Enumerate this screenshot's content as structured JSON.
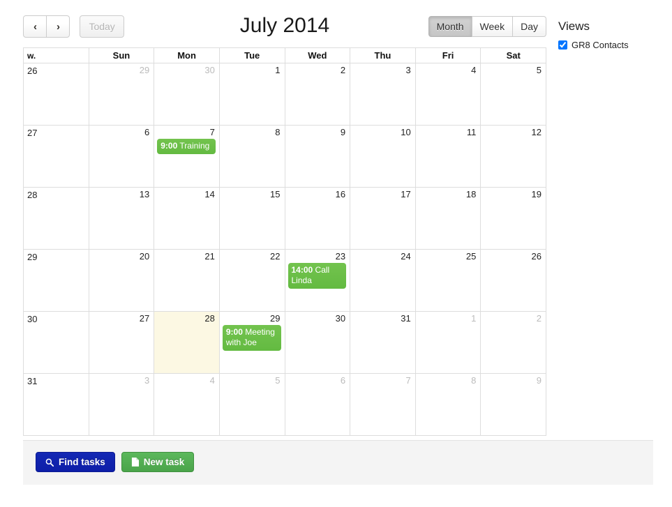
{
  "toolbar": {
    "prev_label": "‹",
    "next_label": "›",
    "prev_icon": "chevron-left-icon",
    "next_icon": "chevron-right-icon",
    "today_label": "Today",
    "title": "July 2014",
    "views": [
      {
        "label": "Month",
        "active": true
      },
      {
        "label": "Week",
        "active": false
      },
      {
        "label": "Day",
        "active": false
      }
    ]
  },
  "views_panel": {
    "title": "Views",
    "items": [
      {
        "label": "GR8 Contacts",
        "checked": true
      }
    ]
  },
  "calendar": {
    "week_header": "w.",
    "day_headers": [
      "Sun",
      "Mon",
      "Tue",
      "Wed",
      "Thu",
      "Fri",
      "Sat"
    ],
    "weeks": [
      {
        "week": "26",
        "days": [
          {
            "num": "29",
            "other": true,
            "today": false,
            "events": []
          },
          {
            "num": "30",
            "other": true,
            "today": false,
            "events": []
          },
          {
            "num": "1",
            "other": false,
            "today": false,
            "events": []
          },
          {
            "num": "2",
            "other": false,
            "today": false,
            "events": []
          },
          {
            "num": "3",
            "other": false,
            "today": false,
            "events": []
          },
          {
            "num": "4",
            "other": false,
            "today": false,
            "events": []
          },
          {
            "num": "5",
            "other": false,
            "today": false,
            "events": []
          }
        ]
      },
      {
        "week": "27",
        "days": [
          {
            "num": "6",
            "other": false,
            "today": false,
            "events": []
          },
          {
            "num": "7",
            "other": false,
            "today": false,
            "events": [
              {
                "time": "9:00",
                "title": "Training",
                "color": "#66bb44"
              }
            ]
          },
          {
            "num": "8",
            "other": false,
            "today": false,
            "events": []
          },
          {
            "num": "9",
            "other": false,
            "today": false,
            "events": []
          },
          {
            "num": "10",
            "other": false,
            "today": false,
            "events": []
          },
          {
            "num": "11",
            "other": false,
            "today": false,
            "events": []
          },
          {
            "num": "12",
            "other": false,
            "today": false,
            "events": []
          }
        ]
      },
      {
        "week": "28",
        "days": [
          {
            "num": "13",
            "other": false,
            "today": false,
            "events": []
          },
          {
            "num": "14",
            "other": false,
            "today": false,
            "events": []
          },
          {
            "num": "15",
            "other": false,
            "today": false,
            "events": []
          },
          {
            "num": "16",
            "other": false,
            "today": false,
            "events": []
          },
          {
            "num": "17",
            "other": false,
            "today": false,
            "events": []
          },
          {
            "num": "18",
            "other": false,
            "today": false,
            "events": []
          },
          {
            "num": "19",
            "other": false,
            "today": false,
            "events": []
          }
        ]
      },
      {
        "week": "29",
        "days": [
          {
            "num": "20",
            "other": false,
            "today": false,
            "events": []
          },
          {
            "num": "21",
            "other": false,
            "today": false,
            "events": []
          },
          {
            "num": "22",
            "other": false,
            "today": false,
            "events": []
          },
          {
            "num": "23",
            "other": false,
            "today": false,
            "events": [
              {
                "time": "14:00",
                "title": "Call Linda",
                "color": "#66bb44"
              }
            ]
          },
          {
            "num": "24",
            "other": false,
            "today": false,
            "events": []
          },
          {
            "num": "25",
            "other": false,
            "today": false,
            "events": []
          },
          {
            "num": "26",
            "other": false,
            "today": false,
            "events": []
          }
        ]
      },
      {
        "week": "30",
        "days": [
          {
            "num": "27",
            "other": false,
            "today": false,
            "events": []
          },
          {
            "num": "28",
            "other": false,
            "today": true,
            "events": []
          },
          {
            "num": "29",
            "other": false,
            "today": false,
            "events": [
              {
                "time": "9:00",
                "title": "Meeting with Joe",
                "color": "#66bb44"
              }
            ]
          },
          {
            "num": "30",
            "other": false,
            "today": false,
            "events": []
          },
          {
            "num": "31",
            "other": false,
            "today": false,
            "events": []
          },
          {
            "num": "1",
            "other": true,
            "today": false,
            "events": []
          },
          {
            "num": "2",
            "other": true,
            "today": false,
            "events": []
          }
        ]
      },
      {
        "week": "31",
        "days": [
          {
            "num": "3",
            "other": true,
            "today": false,
            "events": []
          },
          {
            "num": "4",
            "other": true,
            "today": false,
            "events": []
          },
          {
            "num": "5",
            "other": true,
            "today": false,
            "events": []
          },
          {
            "num": "6",
            "other": true,
            "today": false,
            "events": []
          },
          {
            "num": "7",
            "other": true,
            "today": false,
            "events": []
          },
          {
            "num": "8",
            "other": true,
            "today": false,
            "events": []
          },
          {
            "num": "9",
            "other": true,
            "today": false,
            "events": []
          }
        ]
      }
    ]
  },
  "footer": {
    "find_tasks_label": "Find tasks",
    "find_tasks_icon": "search-icon",
    "new_task_label": "New task",
    "new_task_icon": "file-icon"
  },
  "colors": {
    "event_green": "#66bb44",
    "find_tasks_blue": "#1428b4",
    "new_task_green": "#5cb85c",
    "today_highlight": "#fcf8e3"
  }
}
